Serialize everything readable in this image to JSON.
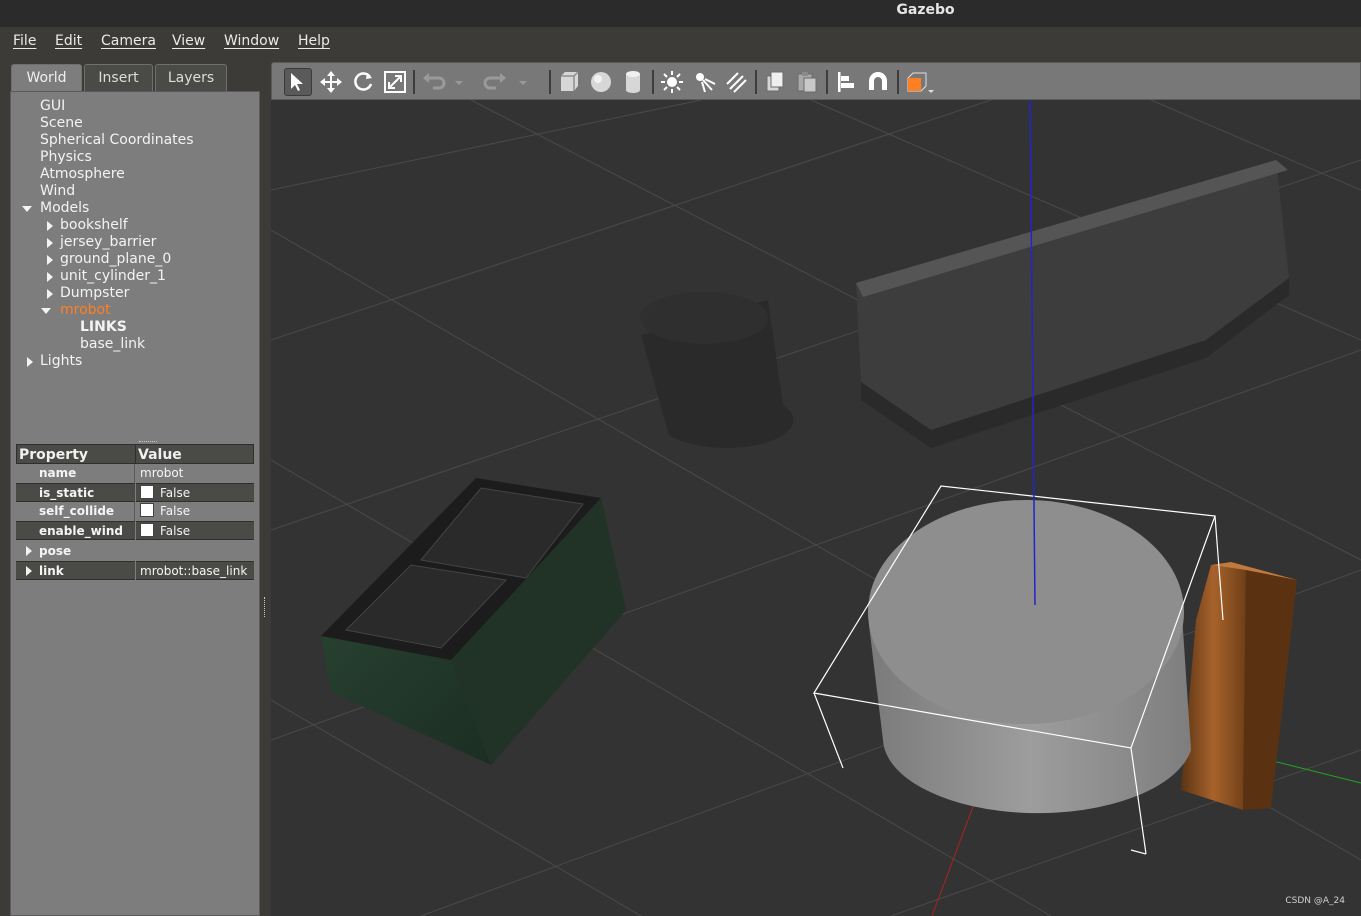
{
  "window": {
    "title": "Gazebo"
  },
  "menu": [
    "File",
    "Edit",
    "Camera",
    "View",
    "Window",
    "Help"
  ],
  "tabs": [
    {
      "label": "World",
      "active": true
    },
    {
      "label": "Insert",
      "active": false
    },
    {
      "label": "Layers",
      "active": false
    }
  ],
  "tree": {
    "gui": "GUI",
    "scene": "Scene",
    "spherical": "Spherical Coordinates",
    "physics": "Physics",
    "atmosphere": "Atmosphere",
    "wind": "Wind",
    "models": "Models",
    "model_items": [
      "bookshelf",
      "jersey_barrier",
      "ground_plane_0",
      "unit_cylinder_1",
      "Dumpster",
      "mrobot"
    ],
    "links_header": "LINKS",
    "link_item": "base_link",
    "lights": "Lights"
  },
  "properties": {
    "header_property": "Property",
    "header_value": "Value",
    "rows": [
      {
        "name": "name",
        "value": "mrobot"
      },
      {
        "name": "is_static",
        "value": "False"
      },
      {
        "name": "self_collide",
        "value": "False"
      },
      {
        "name": "enable_wind",
        "value": "False"
      },
      {
        "name": "pose",
        "value": ""
      },
      {
        "name": "link",
        "value": "mrobot::base_link"
      }
    ]
  },
  "toolbar_icons": [
    "select-icon",
    "translate-icon",
    "rotate-icon",
    "scale-icon",
    "undo-icon",
    "undo-dropdown-icon",
    "redo-icon",
    "redo-dropdown-icon",
    "box-icon",
    "sphere-icon",
    "cylinder-icon",
    "point-light-icon",
    "spot-light-icon",
    "directional-light-icon",
    "copy-icon",
    "paste-icon",
    "align-icon",
    "snap-icon",
    "view-angle-icon"
  ],
  "colors": {
    "selected": "#ff7f24",
    "panel": "#7d7d7d",
    "scene": "#333333"
  },
  "watermark": "CSDN @A_24"
}
